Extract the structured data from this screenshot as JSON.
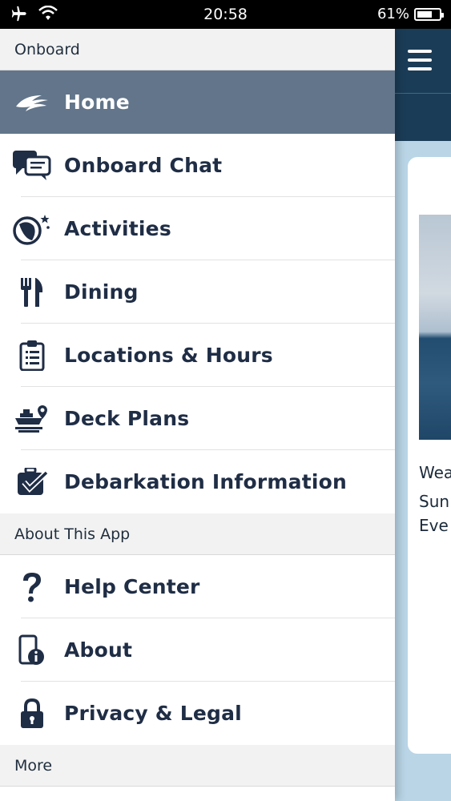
{
  "status_bar": {
    "time": "20:58",
    "battery": "61%",
    "battery_level": 0.61,
    "icons": [
      "airplane-icon",
      "wifi-icon",
      "battery-icon"
    ]
  },
  "colors": {
    "navy": "#1f2d45",
    "active_item_bg": "#62758a",
    "header_bg": "#1b3c57"
  },
  "drawer": {
    "sections": [
      {
        "title": "Onboard",
        "items": [
          {
            "label": "Home",
            "icon": "ship-logo-icon",
            "active": true
          },
          {
            "label": "Onboard Chat",
            "icon": "chat-icon"
          },
          {
            "label": "Activities",
            "icon": "beach-ball-icon"
          },
          {
            "label": "Dining",
            "icon": "fork-knife-icon"
          },
          {
            "label": "Locations & Hours",
            "icon": "clipboard-icon"
          },
          {
            "label": "Deck Plans",
            "icon": "deck-plans-icon"
          },
          {
            "label": "Debarkation Information",
            "icon": "luggage-check-icon"
          }
        ]
      },
      {
        "title": "About This App",
        "items": [
          {
            "label": "Help Center",
            "icon": "question-icon"
          },
          {
            "label": "About",
            "icon": "phone-info-icon"
          },
          {
            "label": "Privacy & Legal",
            "icon": "lock-icon"
          }
        ]
      },
      {
        "title": "More",
        "items": []
      }
    ]
  },
  "main": {
    "card_text": [
      "Wea",
      "Sun",
      "Eve"
    ]
  }
}
